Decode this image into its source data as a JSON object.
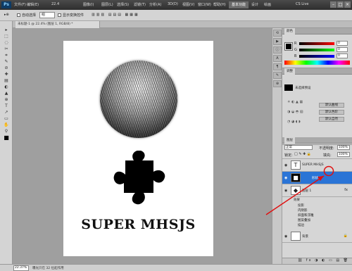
{
  "titlebar": {
    "app": "Ps",
    "menus": [
      "文件(F)",
      "编辑(E)",
      "图像(I)",
      "图层(L)",
      "选择(S)",
      "滤镜(T)",
      "分析(A)",
      "3D(D)",
      "视图(V)",
      "窗口(W)",
      "帮助(H)"
    ],
    "zoom": "22.4",
    "workspace_active": "基本功能",
    "workspace_design": "设计",
    "workspace_paint": "绘画",
    "cs_live": "CS Live"
  },
  "options": {
    "feather_label": "羽化:",
    "feather_value": "",
    "style_label": "样式:",
    "style_value": "组",
    "auto_select": "自动选择",
    "show_transform": "显示变换控件"
  },
  "document": {
    "tab": "未标题-1 @ 22.4% (图层 1, RGB/8) *",
    "canvas_text": "SUPER MHSJS"
  },
  "status": {
    "zoom": "22.37%",
    "doc": "曝光只在 32 位起作用"
  },
  "color": {
    "tab": "颜色",
    "r": "R",
    "g": "G",
    "b": "B",
    "r_val": "0",
    "g_val": "0",
    "b_val": "0"
  },
  "adjust": {
    "tab": "调整",
    "preset": "未选择预设",
    "btn1": "默认曲线",
    "btn2": "默认色阶",
    "btn3": "默认自然"
  },
  "layers": {
    "tab": "图层",
    "mode": "正常",
    "opacity_label": "不透明度:",
    "opacity": "100%",
    "lock_label": "锁定:",
    "fill_label": "填充:",
    "fill": "100%",
    "items": [
      {
        "name": "SUPER MHSJS",
        "thumb": "T"
      },
      {
        "name": "形状 1",
        "thumb": "■"
      },
      {
        "name": "图层 1",
        "thumb": "◆"
      },
      {
        "name": "背景",
        "thumb": ""
      }
    ],
    "effects_label": "效果",
    "effects": [
      "投影",
      "内阴影",
      "斜面和浮雕",
      "图案叠加",
      "描边"
    ],
    "fx": "fx"
  },
  "tools": [
    "▸",
    "⬚",
    "◌",
    "✂",
    "⌗",
    "✎",
    "⊘",
    "✚",
    "▤",
    "◐",
    "▲",
    "⊕",
    "T",
    "↗",
    "▭",
    "✋",
    "⚲",
    "■"
  ],
  "accent": "#2a74d6"
}
